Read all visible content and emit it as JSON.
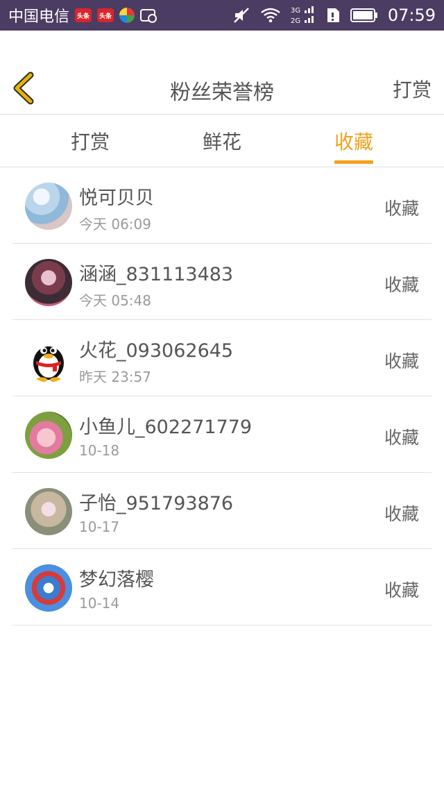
{
  "status_bar": {
    "carrier": "中国电信",
    "badge1": "头条",
    "badge2": "头条",
    "network": "3G 2G",
    "time": "07:59",
    "icons": [
      "toutiao-icon",
      "toutiao-icon",
      "browser-ball-icon",
      "check-chat-icon",
      "mute-icon",
      "wifi-icon",
      "signal-icon",
      "sim-icon",
      "battery-icon"
    ]
  },
  "header": {
    "back_icon": "chevron-left-icon",
    "title": "粉丝荣誉榜",
    "right_action": "打赏"
  },
  "tabs": [
    {
      "label": "打赏",
      "active": false
    },
    {
      "label": "鲜花",
      "active": false
    },
    {
      "label": "收藏",
      "active": true
    }
  ],
  "list": [
    {
      "name": "悦可贝贝",
      "time": "今天 06:09",
      "action": "收藏"
    },
    {
      "name": "涵涵_831113483",
      "time": "今天 05:48",
      "action": "收藏"
    },
    {
      "name": "火花_093062645",
      "time": "昨天 23:57",
      "action": "收藏"
    },
    {
      "name": "小鱼儿_602271779",
      "time": "10-18",
      "action": "收藏"
    },
    {
      "name": "子怡_951793876",
      "time": "10-17",
      "action": "收藏"
    },
    {
      "name": "梦幻落樱",
      "time": "10-14",
      "action": "收藏"
    }
  ],
  "colors": {
    "status_bar": "#4b3c63",
    "accent": "#f3a11b",
    "back_icon": "#e8b400"
  }
}
